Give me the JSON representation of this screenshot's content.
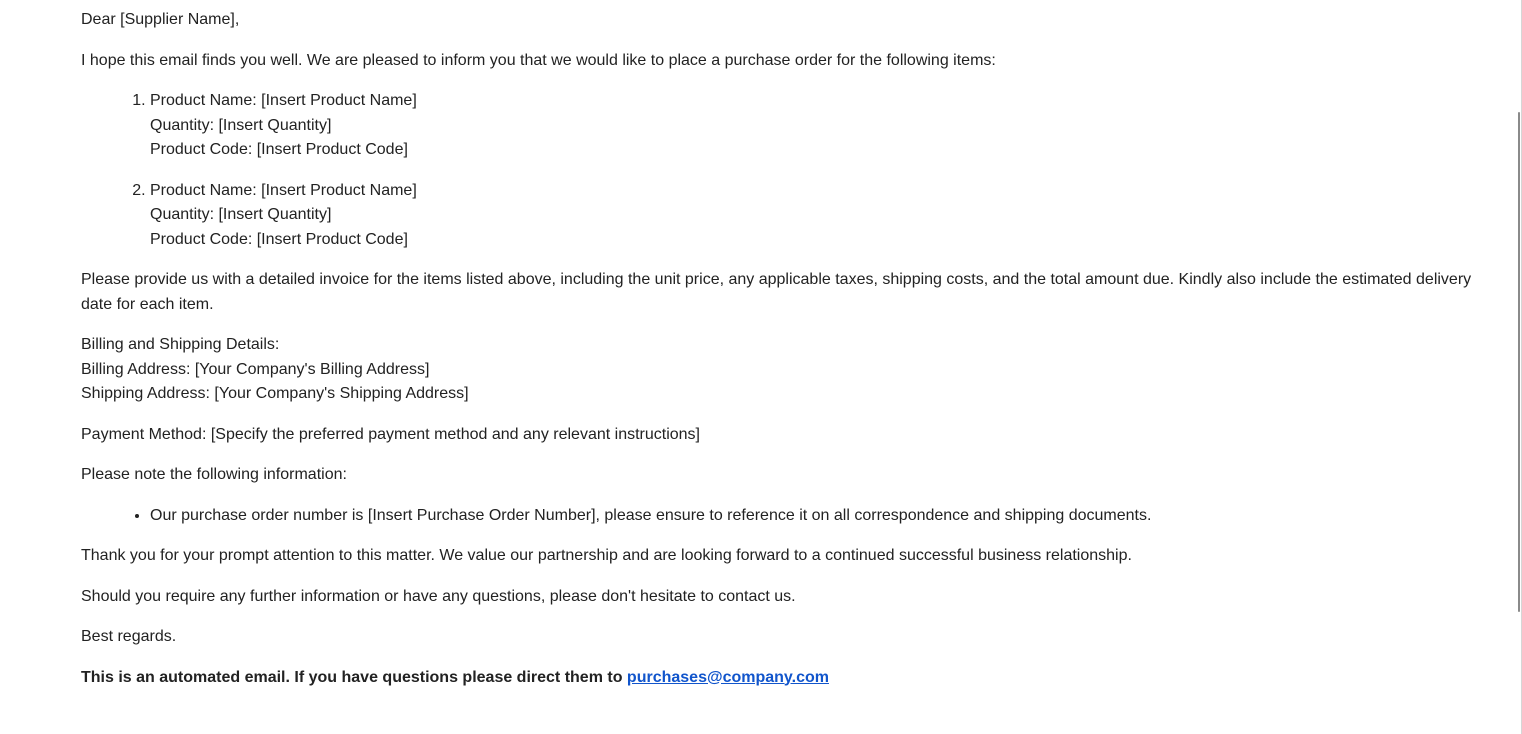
{
  "email": {
    "greeting": "Dear [Supplier Name],",
    "intro": "I hope this email finds you well. We are pleased to inform you that we would like to place a purchase order for the following items:",
    "items": [
      {
        "product_name": "Product Name: [Insert Product Name]",
        "quantity": "Quantity: [Insert Quantity]",
        "product_code": "Product Code: [Insert Product Code]"
      },
      {
        "product_name": "Product Name: [Insert Product Name]",
        "quantity": "Quantity: [Insert Quantity]",
        "product_code": "Product Code: [Insert Product Code]"
      }
    ],
    "invoice_request": "Please provide us with a detailed invoice for the items listed above, including the unit price, any applicable taxes, shipping costs, and the total amount due. Kindly also include the estimated delivery date for each item.",
    "billing": {
      "heading": "Billing and Shipping Details:",
      "billing_address": "Billing Address: [Your Company's Billing Address]",
      "shipping_address": "Shipping Address: [Your Company's Shipping Address]"
    },
    "payment_method": "Payment Method: [Specify the preferred payment method and any relevant instructions]",
    "note_intro": "Please note the following information:",
    "notes": [
      "Our purchase order number is [Insert Purchase Order Number], please ensure to reference it on all correspondence and shipping documents."
    ],
    "thanks": "Thank you for your prompt attention to this matter. We value our partnership and are looking forward to a continued successful business relationship.",
    "contact": "Should you require any further information or have any questions, please don't hesitate to contact us.",
    "signoff": "Best regards.",
    "footer": {
      "text": "This is an automated email. If you have questions please direct them to ",
      "email_link": "purchases@company.com"
    }
  },
  "colors": {
    "text": "#222222",
    "link": "#1155cc"
  }
}
